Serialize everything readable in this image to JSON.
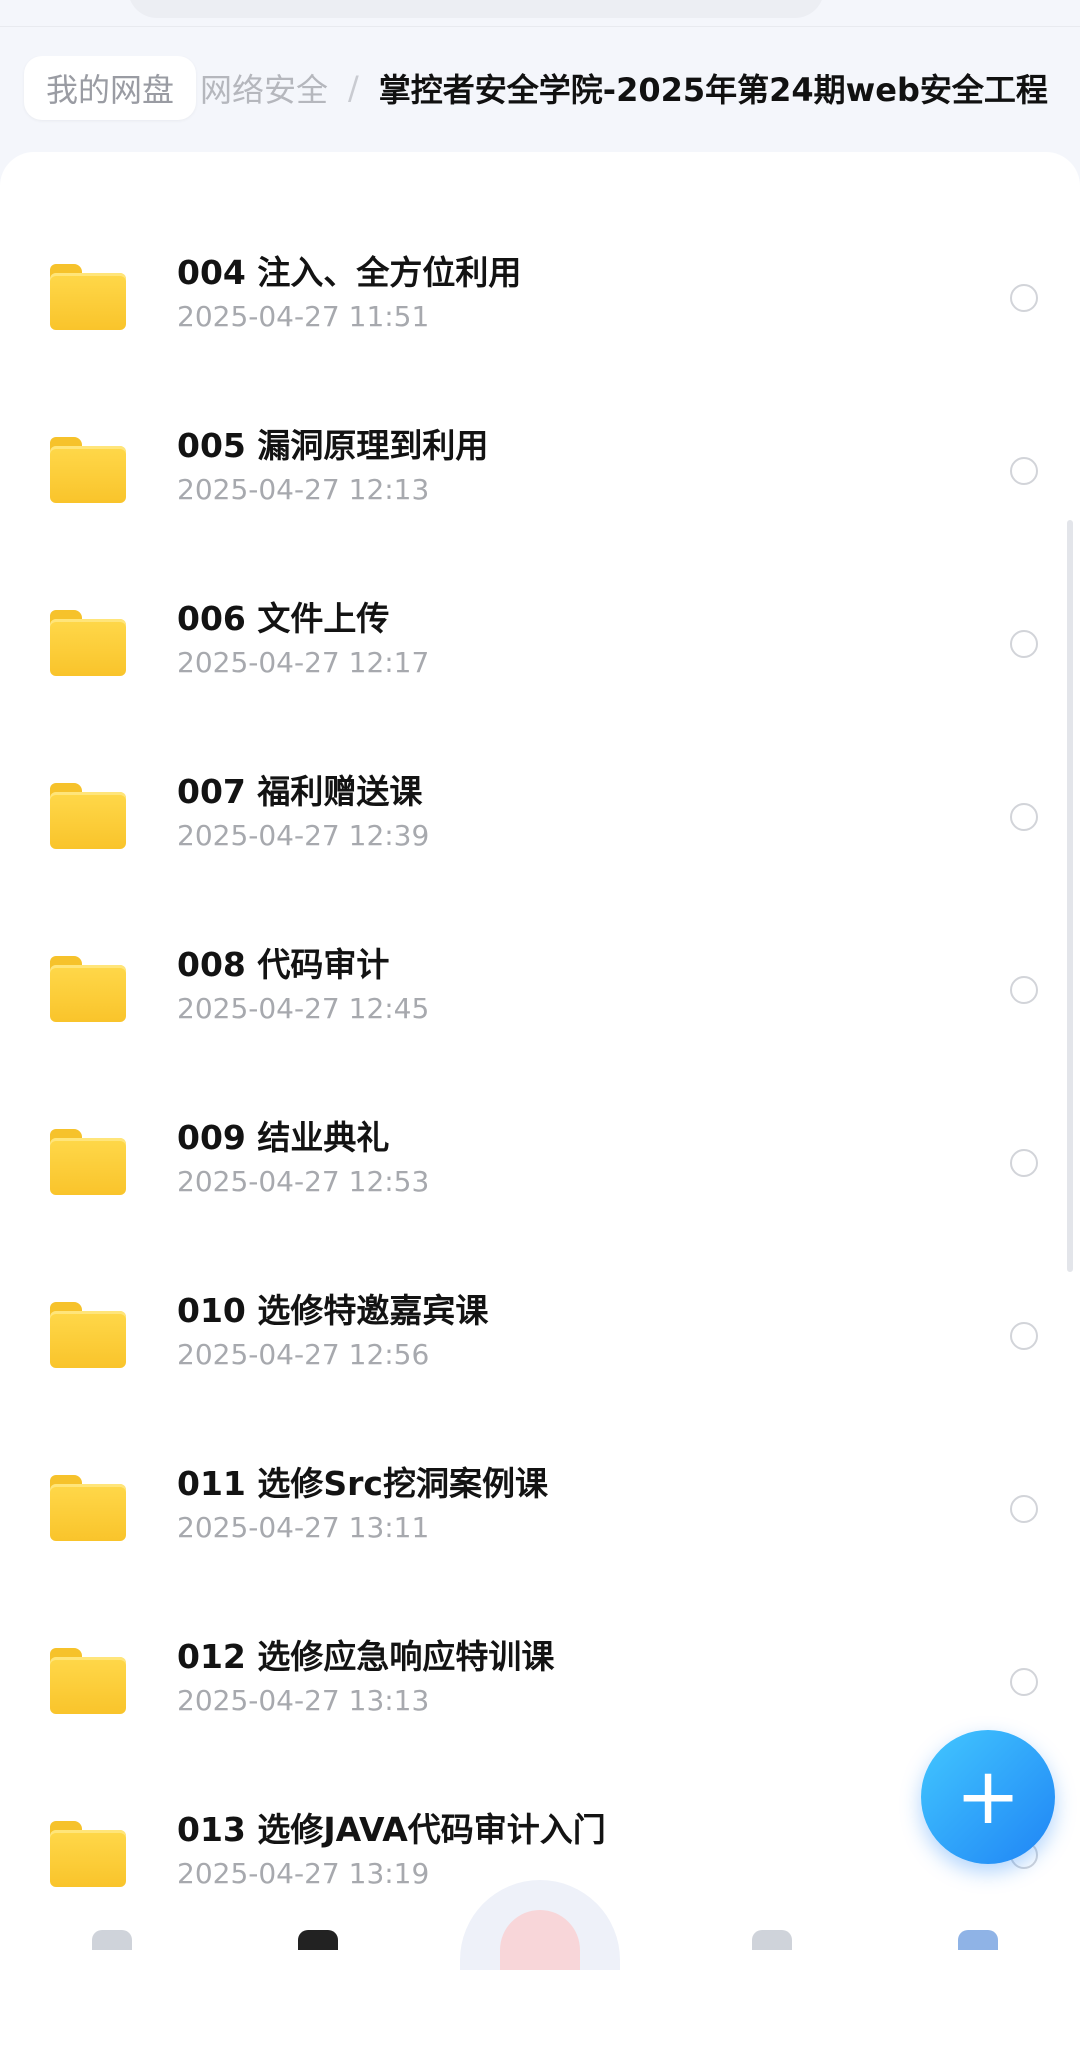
{
  "breadcrumb": {
    "home": "我的网盘",
    "middle": "网络安全",
    "separator": "/",
    "current": "掌控者安全学院-2025年第24期web安全工程"
  },
  "files": [
    {
      "name": "004 注入、全方位利用",
      "date": "2025-04-27 11:51"
    },
    {
      "name": "005 漏洞原理到利用",
      "date": "2025-04-27 12:13"
    },
    {
      "name": "006 文件上传",
      "date": "2025-04-27 12:17"
    },
    {
      "name": "007 福利赠送课",
      "date": "2025-04-27 12:39"
    },
    {
      "name": "008 代码审计",
      "date": "2025-04-27 12:45"
    },
    {
      "name": "009 结业典礼",
      "date": "2025-04-27 12:53"
    },
    {
      "name": "010 选修特邀嘉宾课",
      "date": "2025-04-27 12:56"
    },
    {
      "name": "011 选修Src挖洞案例课",
      "date": "2025-04-27 13:11"
    },
    {
      "name": "012 选修应急响应特训课",
      "date": "2025-04-27 13:13"
    },
    {
      "name": "013 选修JAVA代码审计入门",
      "date": "2025-04-27 13:19"
    }
  ],
  "fab": {
    "label": "+"
  },
  "icons": {
    "folder": "folder-icon",
    "checkbox": "radio-circle-icon",
    "add": "plus-icon"
  },
  "colors": {
    "accent": "#1f84f5",
    "folder": "#f9c42b"
  }
}
